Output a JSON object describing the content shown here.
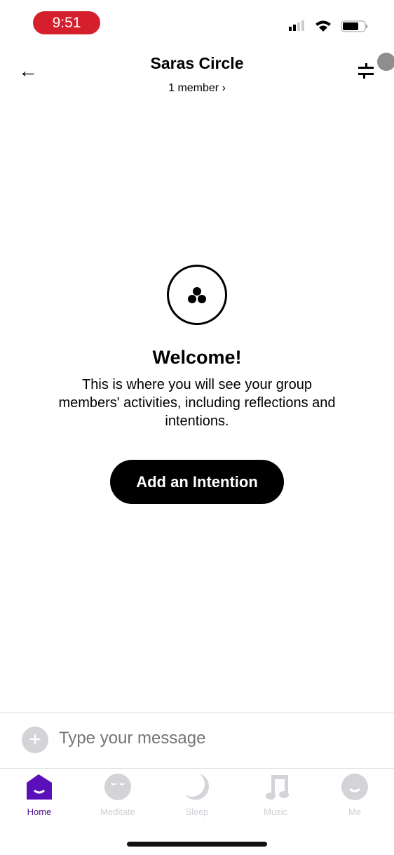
{
  "status_bar": {
    "time": "9:51"
  },
  "header": {
    "title": "Saras Circle",
    "subtitle": "1 member ›"
  },
  "empty_state": {
    "heading": "Welcome!",
    "description": "This is where you will see your group members' activities, including reflections and intentions.",
    "button": "Add an Intention"
  },
  "composer": {
    "placeholder": "Type your message"
  },
  "tabs": [
    {
      "label": "Home",
      "icon": "home-icon",
      "active": true
    },
    {
      "label": "Meditate",
      "icon": "meditate-icon"
    },
    {
      "label": "Sleep",
      "icon": "moon-icon"
    },
    {
      "label": "Music",
      "icon": "music-icon"
    },
    {
      "label": "Me",
      "icon": "profile-icon"
    }
  ],
  "colors": {
    "accent": "#5b0fb8",
    "inactive": "#d0cfd5",
    "time_pill": "#d61f2c"
  }
}
